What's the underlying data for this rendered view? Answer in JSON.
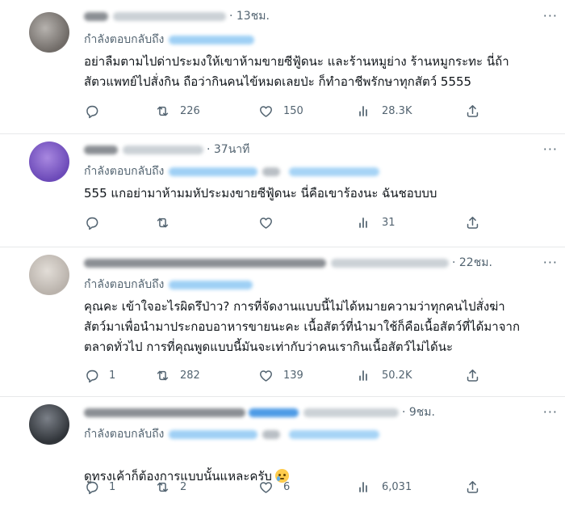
{
  "tweets": [
    {
      "time": "· 13ชม.",
      "reply_prefix": "กำลังตอบกลับถึง",
      "text": "อย่าลืมตามไปด่าประมงให้เขาห้ามขายซีฟู้ดนะ และร้านหมูย่าง ร้านหมูกระทะ  นี่ถ้า\nสัตวแพทย์ไปสั่งกิน ถือว่ากินคนไข้หมดเลยป่ะ ก็ทำอาชีพรักษาทุกสัตว์ 5555",
      "stats": {
        "replies": "",
        "retweets": "226",
        "likes": "150",
        "views": "28.3K"
      }
    },
    {
      "time": "· 37นาที",
      "reply_prefix": "กำลังตอบกลับถึง",
      "text": "555 แกอย่ามาห้ามมหัประมงขายซีฟู้ดนะ นี่คือเขาร้องนะ  ฉันชอบบบ",
      "stats": {
        "replies": "",
        "retweets": "",
        "likes": "",
        "views": "31"
      }
    },
    {
      "time": "· 22ชม.",
      "reply_prefix": "กำลังตอบกลับถึง",
      "text": "คุณคะ เข้าใจอะไรผิดรึป่าว? การที่จัดงานแบบนี้ไม่ได้หมายความว่าทุกคนไปสั่งฆ่า\nสัตว์มาเพื่อนำมาประกอบอาหารขายนะคะ เนื้อสัตว์ที่นำมาใช้ก็คือเนื้อสัตว์ที่ได้มาจาก\nตลาดทั่วไป การที่คุณพูดแบบนี้มันจะเท่ากับว่าคนเรากินเนื้อสัตว์ไม่ได้นะ",
      "stats": {
        "replies": "1",
        "retweets": "282",
        "likes": "139",
        "views": "50.2K"
      }
    },
    {
      "time": "· 9ชม.",
      "reply_prefix": "กำลังตอบกลับถึง",
      "text": "ดูทรงเค้าก็ต้องการแบบนั้นแหละครับ",
      "stats": {
        "replies": "1",
        "retweets": "2",
        "likes": "6",
        "views": "6,031"
      }
    }
  ],
  "colors": {
    "text": "#0f1419",
    "secondary": "#536471",
    "divider": "#e7e9ea",
    "link_blur": "#9fd0f5"
  },
  "icons": [
    "reply-icon",
    "retweet-icon",
    "like-icon",
    "views-icon",
    "share-icon",
    "more-icon",
    "crying-smile-emoji"
  ]
}
